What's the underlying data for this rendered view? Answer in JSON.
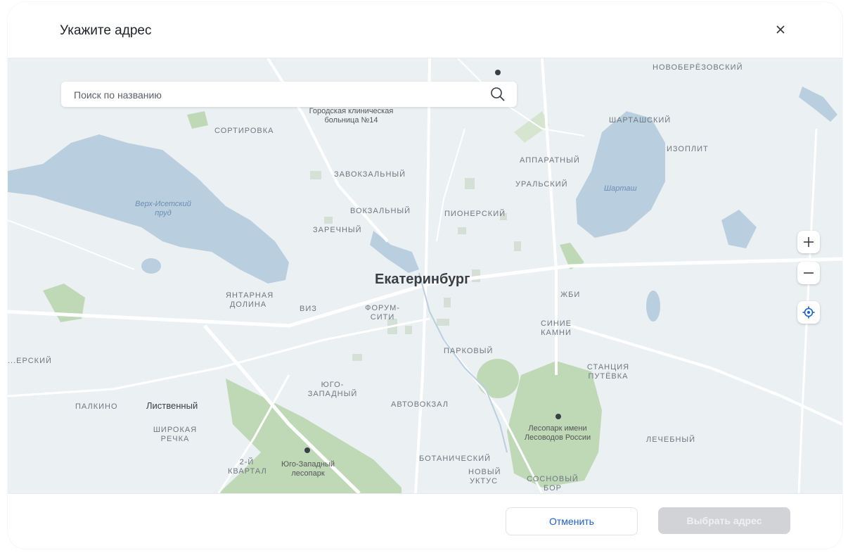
{
  "dialog": {
    "title": "Укажите адрес",
    "close_label": "×"
  },
  "search": {
    "placeholder": "Поиск по названию"
  },
  "map": {
    "city": "Екатеринбург",
    "labels": {
      "novoberezovsky": "НОВОБЕРЁЗОВСКИЙ",
      "hospital": "Городская клиническая больница №14",
      "sortirovka": "СОРТИРОВКА",
      "shartashsky": "ШАРТАШСКИЙ",
      "izoplit": "ИЗОПЛИТ",
      "apparatny": "АППАРАТНЫЙ",
      "zavokzalny": "ЗАВОКЗАЛЬНЫЙ",
      "uralsky": "УРАЛЬСКИЙ",
      "shartash_lake": "Шарташ",
      "verkh_isetsky": "Верх-Исетский пруд",
      "vokzalny": "ВОКЗАЛЬНЫЙ",
      "pionersky": "ПИОНЕРСКИЙ",
      "zarechny": "ЗАРЕЧНЫЙ",
      "yantarnaya": "ЯНТАРНАЯ ДОЛИНА",
      "viz": "ВИЗ",
      "forum": "ФОРУМ-СИТИ",
      "zhbi": "ЖБИ",
      "sinie_kamni": "СИНИЕ КАМНИ",
      "parkovy": "ПАРКОВЫЙ",
      "stantsiya": "СТАНЦИЯ ПУТЁВКА",
      "verkhisetsky_west": "...ЕРСКИЙ",
      "yugo_zapadny": "ЮГО-ЗАПАДНЫЙ",
      "palkino": "ПАЛКИНО",
      "listvenny": "Лиственный",
      "avtovokzal": "АВТОВОКЗАЛ",
      "shirokaya_rechka": "ШИРОКАЯ РЕЧКА",
      "lesopark_lesovodov": "Лесопарк имени Лесоводов России",
      "lechebny": "ЛЕЧЕБНЫЙ",
      "vtoroy_kvartal": "2-Й КВАРТАЛ",
      "yugo_zapadny_lesopark": "Юго-Западный лесопарк",
      "botanichesky": "БОТАНИЧЕСКИЙ",
      "novy_uktus": "НОВЫЙ УКТУС",
      "sosnovy_bor": "СОСНОВЫЙ БОР"
    },
    "zoom_in_label": "+",
    "zoom_out_label": "−"
  },
  "footer": {
    "cancel_label": "Отменить",
    "select_label": "Выбрать адрес"
  },
  "colors": {
    "water": "#b9cfdf",
    "forest": "#bfd9b7",
    "road": "#ffffff",
    "land": "#ebf0f2",
    "accent": "#1c5fc7"
  },
  "icons": {
    "close": "close-icon",
    "search": "search-icon",
    "zoom_in": "plus-icon",
    "zoom_out": "minus-icon",
    "locate": "locate-icon"
  }
}
